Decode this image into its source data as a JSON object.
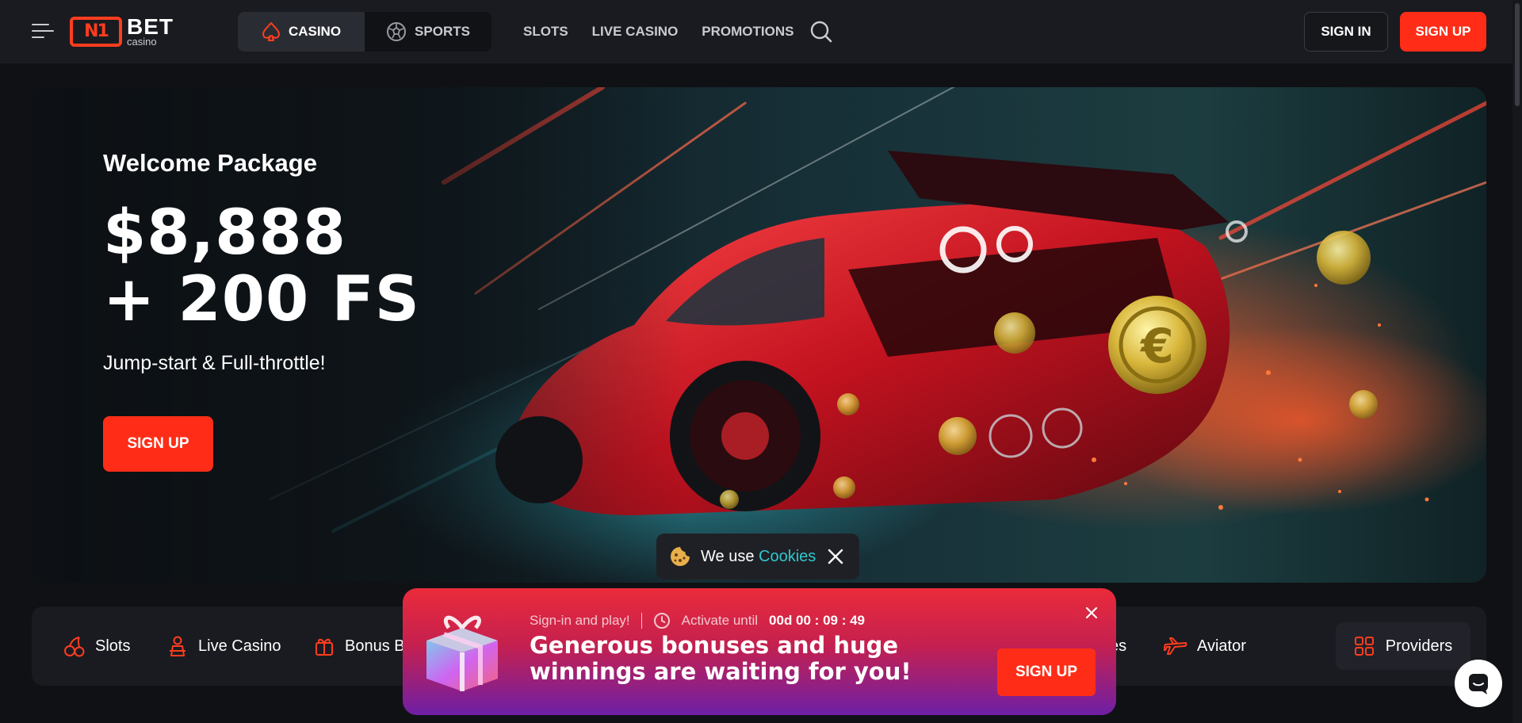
{
  "header": {
    "logo_mark": "N1",
    "logo_brand": "BET",
    "logo_sub": "casino",
    "modes": [
      {
        "label": "CASINO",
        "icon": "spade-icon",
        "active": true
      },
      {
        "label": "SPORTS",
        "icon": "soccer-ball-icon",
        "active": false
      }
    ],
    "nav": [
      "SLOTS",
      "LIVE CASINO",
      "PROMOTIONS"
    ],
    "sign_in": "SIGN IN",
    "sign_up": "SIGN UP"
  },
  "hero": {
    "kicker": "Welcome Package",
    "amount_line1": "$8,888",
    "amount_line2": "+ 200 FS",
    "tagline": "Jump-start & Full-throttle!",
    "cta": "SIGN UP"
  },
  "categories": {
    "items": [
      {
        "label": "Slots",
        "icon": "cherry-icon"
      },
      {
        "label": "Live Casino",
        "icon": "dealer-icon"
      },
      {
        "label": "Bonus B",
        "icon": "gift-icon"
      },
      {
        "label": "es",
        "icon": ""
      },
      {
        "label": "Aviator",
        "icon": "plane-icon"
      }
    ],
    "providers": "Providers"
  },
  "cookie": {
    "prefix": "We use",
    "link": "Cookies"
  },
  "promo": {
    "sign_in_text": "Sign-in and play!",
    "activate_label": "Activate until",
    "timer": "00d 00 : 09 : 49",
    "title": "Generous bonuses and huge winnings are waiting for you!",
    "cta": "SIGN UP"
  },
  "colors": {
    "accent": "#ff2d17",
    "background": "#101115",
    "panel": "#1a1b20",
    "cookie_link": "#2ec8cf"
  }
}
